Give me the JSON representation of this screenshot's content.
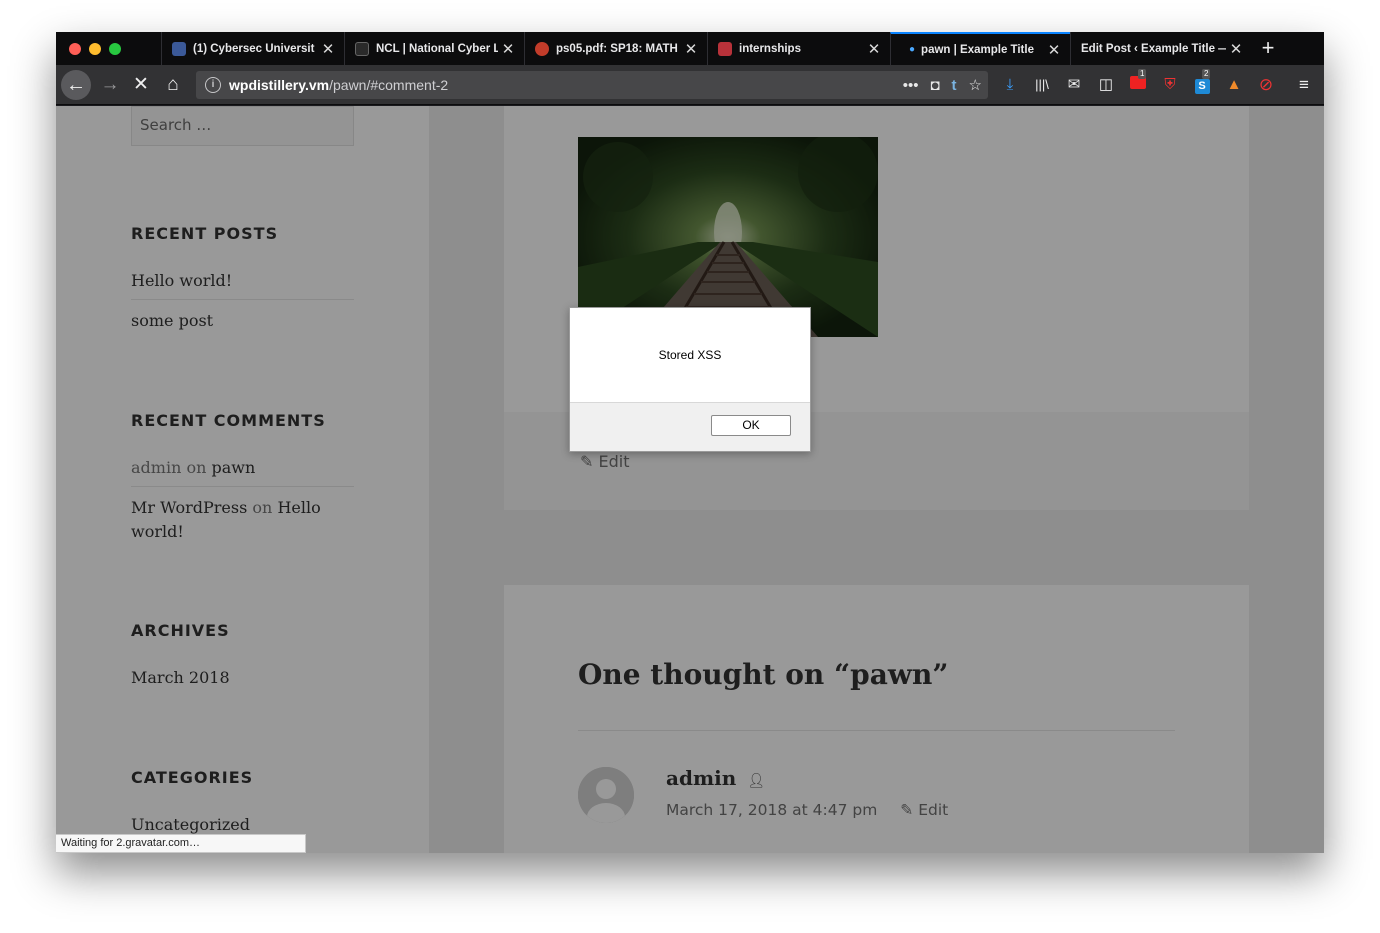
{
  "tabs": [
    {
      "title": "(1) Cybersec Universit",
      "favicon_color": "#3b5998"
    },
    {
      "title": "NCL | National Cyber L",
      "favicon_color": "#2a2a2a"
    },
    {
      "title": "ps05.pdf: SP18: MATH",
      "favicon_color": "#c23c2a"
    },
    {
      "title": "internships",
      "favicon_color": "#b8323a"
    },
    {
      "title": "pawn | Example Title",
      "active": true
    },
    {
      "title": "Edit Post ‹ Example Title —"
    }
  ],
  "navbar": {
    "url_host": "wpdistillery.vm",
    "url_path": "/pawn/#comment-2",
    "more_label": "•••",
    "badge_1": "1",
    "badge_2": "2"
  },
  "sidebar": {
    "search_placeholder": "Search …",
    "recent_posts_title": "RECENT POSTS",
    "recent_posts": [
      "Hello world!",
      "some post"
    ],
    "recent_comments_title": "RECENT COMMENTS",
    "comment_1": {
      "author": "admin",
      "on": "on",
      "post": "pawn"
    },
    "comment_2": {
      "author": "Mr WordPress",
      "on": "on",
      "post_line1": "Hello",
      "post_line2": "world!"
    },
    "archives_title": "ARCHIVES",
    "archives": [
      "March 2018"
    ],
    "categories_title": "CATEGORIES",
    "categories": [
      "Uncategorized"
    ]
  },
  "post": {
    "edit_label": "Edit"
  },
  "comments": {
    "title": "One thought on “pawn”",
    "author": "admin",
    "date": "March 17, 2018 at 4:47 pm",
    "edit_label": "Edit"
  },
  "alert": {
    "message": "Stored XSS",
    "ok_label": "OK"
  },
  "status_bar": "Waiting for 2.gravatar.com…",
  "colors": {
    "accent": "#0a84ff",
    "chrome_dark": "#0c0c0d",
    "toolbar": "#323234"
  }
}
